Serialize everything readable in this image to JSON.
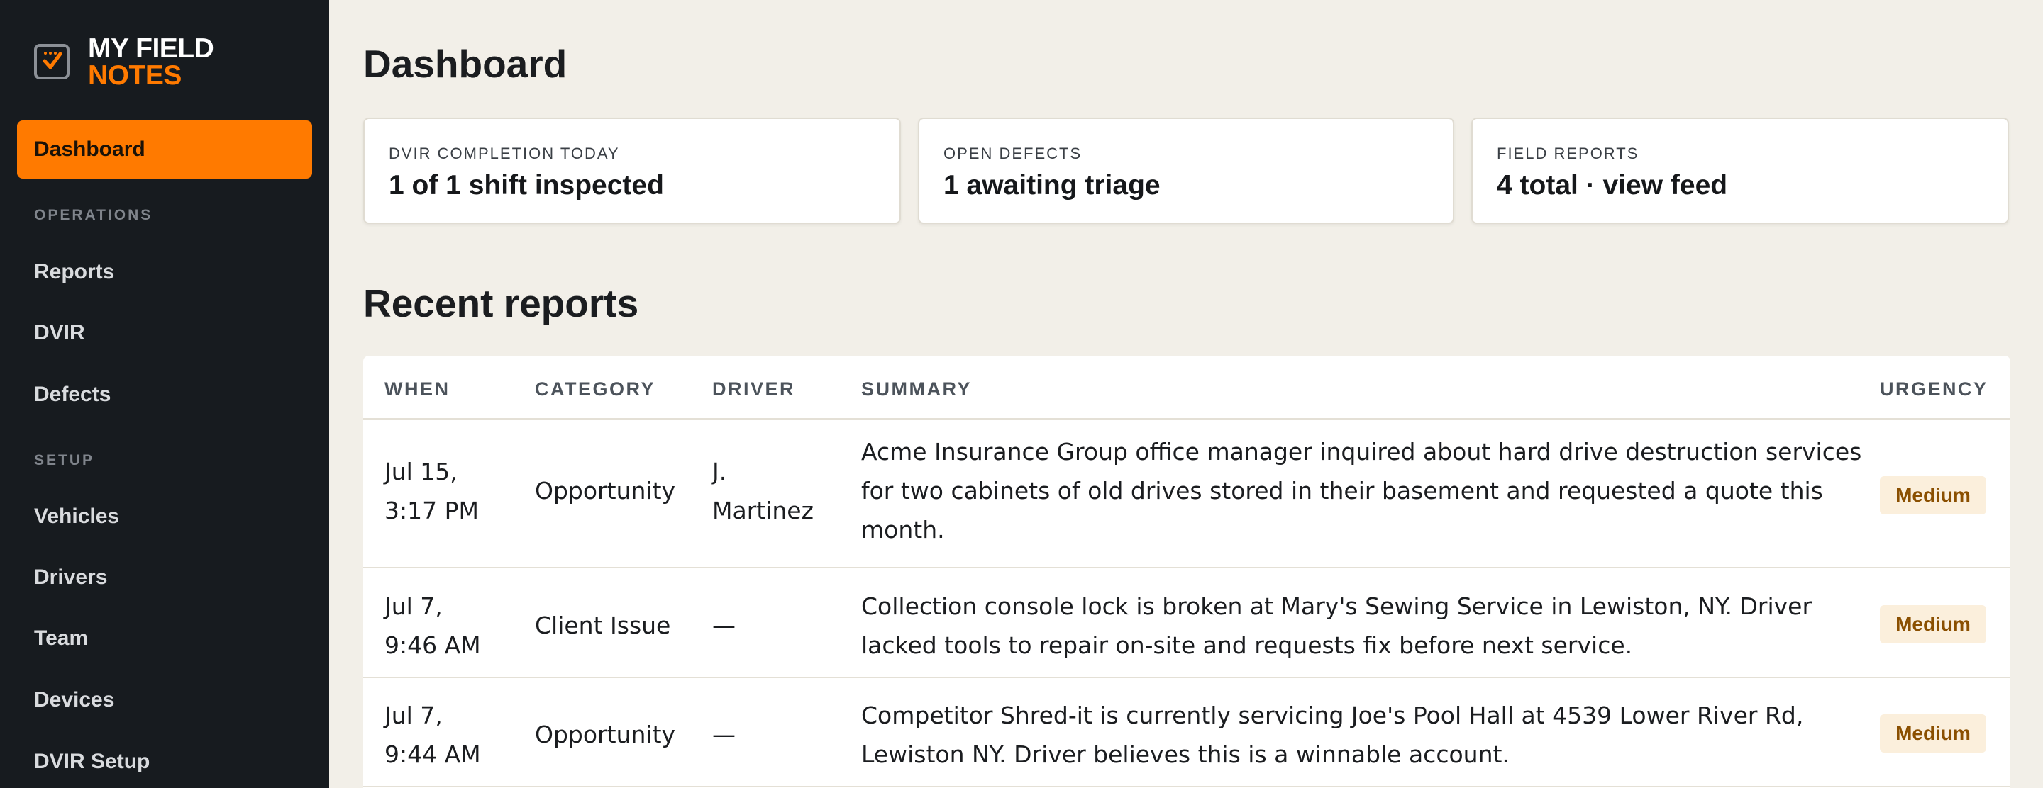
{
  "app": {
    "logo_line1": "MY FIELD",
    "logo_line2": "NOTES",
    "accent_color": "#ff7a00",
    "logo_icon": "checkbox-icon"
  },
  "sidebar": {
    "active_item": "Dashboard",
    "section_operations": "OPERATIONS",
    "operations_items": [
      "Reports",
      "DVIR",
      "Defects"
    ],
    "section_setup": "SETUP",
    "setup_items": [
      "Vehicles",
      "Drivers",
      "Team",
      "Devices",
      "DVIR Setup"
    ]
  },
  "main": {
    "title": "Dashboard",
    "cards": [
      {
        "label": "DVIR COMPLETION TODAY",
        "value": "1 of 1 shift inspected"
      },
      {
        "label": "OPEN DEFECTS",
        "value": "1 awaiting triage"
      },
      {
        "label": "FIELD REPORTS",
        "value": "4 total · view feed"
      }
    ],
    "recent_title": "Recent reports",
    "table": {
      "headers": [
        "WHEN",
        "CATEGORY",
        "DRIVER",
        "SUMMARY",
        "URGENCY"
      ],
      "rows": [
        {
          "when_date": "Jul 15,",
          "when_time": "3:17 PM",
          "category": "Opportunity",
          "driver_line1": "J.",
          "driver_line2": "Martinez",
          "summary": "Acme Insurance Group office manager inquired about hard drive destruction services for two cabinets of old drives stored in their basement and requested a quote this month.",
          "urgency": "Medium"
        },
        {
          "when_date": "Jul 7,",
          "when_time": "9:46 AM",
          "category": "Client Issue",
          "driver_line1": "—",
          "driver_line2": "",
          "summary": "Collection console lock is broken at Mary's Sewing Service in Lewiston, NY. Driver lacked tools to repair on-site and requests fix before next service.",
          "urgency": "Medium"
        },
        {
          "when_date": "Jul 7,",
          "when_time": "9:44 AM",
          "category": "Opportunity",
          "driver_line1": "—",
          "driver_line2": "",
          "summary": "Competitor Shred-it is currently servicing Joe's Pool Hall at 4539 Lower River Rd, Lewiston NY. Driver believes this is a winnable account.",
          "urgency": "Medium"
        }
      ]
    }
  }
}
